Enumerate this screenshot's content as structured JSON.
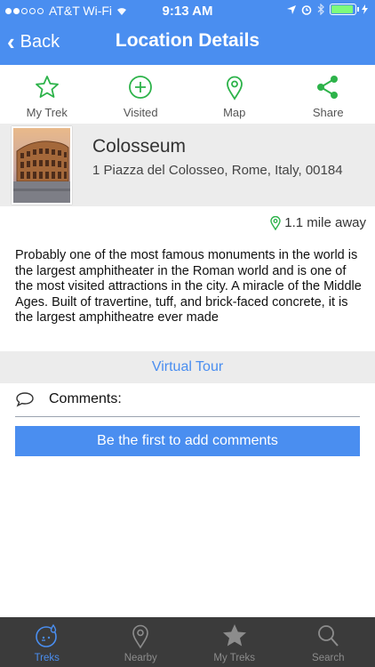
{
  "status_bar": {
    "carrier": "AT&T Wi-Fi",
    "time": "9:13 AM"
  },
  "nav": {
    "back_label": "Back",
    "title": "Location Details"
  },
  "actions": [
    {
      "label": "My Trek",
      "icon": "star-outline-icon"
    },
    {
      "label": "Visited",
      "icon": "plus-circle-icon"
    },
    {
      "label": "Map",
      "icon": "map-pin-icon"
    },
    {
      "label": "Share",
      "icon": "share-icon"
    }
  ],
  "location": {
    "name": "Colosseum",
    "address": "1 Piazza del Colosseo, Rome, Italy, 00184",
    "distance": "1.1 mile away",
    "description": "Probably one of the most famous monuments in the world is the largest amphitheater in the Roman world and is one of the most visited attractions in the city. A miracle of the Middle Ages. Built of travertine, tuff, and brick-faced concrete, it is the largest amphitheatre ever made"
  },
  "virtual_tour": {
    "label": "Virtual Tour"
  },
  "comments": {
    "label": "Comments:",
    "add_button": "Be the first to add comments"
  },
  "tabs": [
    {
      "label": "Treks",
      "icon": "treks-icon",
      "active": true
    },
    {
      "label": "Nearby",
      "icon": "map-pin-icon",
      "active": false
    },
    {
      "label": "My Treks",
      "icon": "star-icon",
      "active": false
    },
    {
      "label": "Search",
      "icon": "search-icon",
      "active": false
    }
  ],
  "colors": {
    "header": "#4a8ef0",
    "accent_green": "#2db34a",
    "tabbar": "#3b3b3b",
    "card_bg": "#ececec"
  }
}
